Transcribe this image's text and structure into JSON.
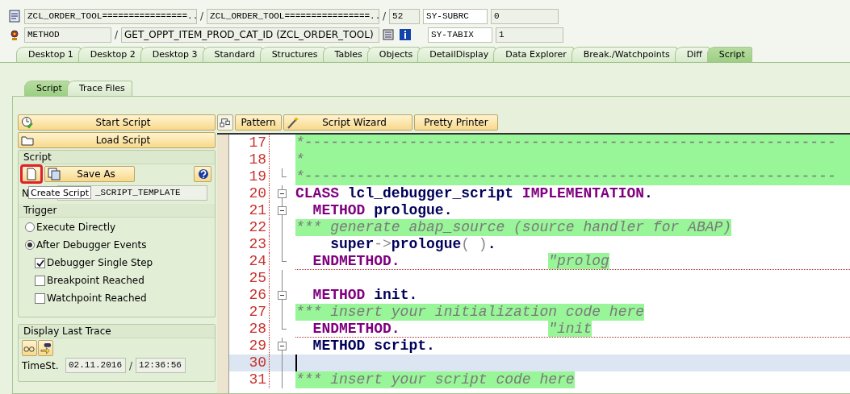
{
  "header": {
    "row_1": {
      "program": "ZCL_ORDER_TOOL================..",
      "include": "ZCL_ORDER_TOOL================..",
      "line": "52",
      "sysvar": "SY-SUBRC",
      "sysvalue": "0"
    },
    "row_2": {
      "event_type": "METHOD",
      "event": "GET_OPPT_ITEM_PROD_CAT_ID (ZCL_ORDER_TOOL)",
      "sysvar": "SY-TABIX",
      "sysvalue": "1"
    },
    "separator": "/"
  },
  "tabs": [
    {
      "label": "Desktop 1",
      "selected": false
    },
    {
      "label": "Desktop 2",
      "selected": false
    },
    {
      "label": "Desktop 3",
      "selected": false
    },
    {
      "label": "Standard",
      "selected": false
    },
    {
      "label": "Structures",
      "selected": false
    },
    {
      "label": "Tables",
      "selected": false
    },
    {
      "label": "Objects",
      "selected": false
    },
    {
      "label": "DetailDisplay",
      "selected": false
    },
    {
      "label": "Data Explorer",
      "selected": false
    },
    {
      "label": "Break./Watchpoints",
      "selected": false
    },
    {
      "label": "Diff",
      "selected": false
    },
    {
      "label": "Script",
      "selected": true
    }
  ],
  "subtabs": [
    {
      "label": "Script",
      "selected": true
    },
    {
      "label": "Trace Files",
      "selected": false
    }
  ],
  "left_panel": {
    "start_button": "Start Script",
    "load_button": "Load Script",
    "script_group": {
      "title": "Script",
      "save_as_button": "Save As",
      "name_label": "N",
      "name_value": "_SCRIPT_TEMPLATE",
      "tooltip": "Create Script",
      "new_button_highlighted": true
    },
    "trigger_group": {
      "title": "Trigger",
      "options": [
        {
          "kind": "radio",
          "label": "Execute Directly",
          "selected": false
        },
        {
          "kind": "radio",
          "label": "After Debugger Events",
          "selected": true
        },
        {
          "kind": "checkbox",
          "label": "Debugger Single Step",
          "checked": true
        },
        {
          "kind": "checkbox",
          "label": "Breakpoint Reached",
          "checked": false
        },
        {
          "kind": "checkbox",
          "label": "Watchpoint Reached",
          "checked": false
        }
      ]
    },
    "trace_group": {
      "title": "Display Last Trace",
      "timestamp_label": "TimeSt.",
      "date": "02.11.2016",
      "separator": "/",
      "time": "12:36:56"
    }
  },
  "editor": {
    "toolbar": {
      "pattern_button": "Pattern",
      "wizard_button": "Script Wizard",
      "pretty_printer_button": "Pretty Printer"
    },
    "lines": [
      {
        "number": "17",
        "collapsible": false,
        "block_end": false,
        "current": false,
        "separator": false,
        "segments": [
          {
            "kind": "comment",
            "text": "*-------------------------------------------------------------",
            "fill": true
          }
        ]
      },
      {
        "number": "18",
        "collapsible": false,
        "block_end": false,
        "current": false,
        "separator": false,
        "segments": [
          {
            "kind": "comment",
            "text": "*",
            "fill": true
          }
        ]
      },
      {
        "number": "19",
        "collapsible": false,
        "block_end": true,
        "current": false,
        "separator": false,
        "segments": [
          {
            "kind": "comment",
            "text": "*-------------------------------------------------------------",
            "fill": true
          }
        ]
      },
      {
        "number": "20",
        "collapsible": true,
        "block_end": false,
        "current": false,
        "separator": false,
        "segments": [
          {
            "kind": "keyword",
            "text": "CLASS"
          },
          {
            "kind": "ident",
            "text": " lcl_debugger_script "
          },
          {
            "kind": "keyword",
            "text": "IMPLEMENTATION"
          },
          {
            "kind": "ident",
            "text": "."
          }
        ]
      },
      {
        "number": "21",
        "collapsible": true,
        "block_end": false,
        "current": false,
        "separator": false,
        "segments": [
          {
            "kind": "keyword",
            "text": "  METHOD"
          },
          {
            "kind": "ident",
            "text": " prologue."
          }
        ]
      },
      {
        "number": "22",
        "collapsible": false,
        "block_end": false,
        "current": false,
        "separator": false,
        "segments": [
          {
            "kind": "comment",
            "text": "*** generate abap_source (source handler for ABAP)"
          }
        ]
      },
      {
        "number": "23",
        "collapsible": false,
        "block_end": false,
        "current": false,
        "separator": false,
        "segments": [
          {
            "kind": "ident",
            "text": "    super"
          },
          {
            "kind": "op",
            "text": "->"
          },
          {
            "kind": "ident",
            "text": "prologue"
          },
          {
            "kind": "op",
            "text": "( )"
          },
          {
            "kind": "ident",
            "text": "."
          }
        ]
      },
      {
        "number": "24",
        "collapsible": false,
        "block_end": true,
        "current": false,
        "separator": true,
        "segments": [
          {
            "kind": "keyword",
            "text": "  ENDMETHOD.                 "
          },
          {
            "kind": "comment",
            "text": "\"prolog"
          }
        ]
      },
      {
        "number": "25",
        "collapsible": false,
        "block_end": false,
        "current": false,
        "separator": false
      },
      {
        "number": "26",
        "collapsible": true,
        "block_end": false,
        "current": false,
        "separator": false,
        "segments": [
          {
            "kind": "keyword",
            "text": "  METHOD"
          },
          {
            "kind": "ident",
            "text": " init."
          }
        ]
      },
      {
        "number": "27",
        "collapsible": false,
        "block_end": false,
        "current": false,
        "separator": false,
        "segments": [
          {
            "kind": "comment",
            "text": "*** insert your initialization code here"
          }
        ]
      },
      {
        "number": "28",
        "collapsible": false,
        "block_end": true,
        "current": false,
        "separator": true,
        "segments": [
          {
            "kind": "keyword",
            "text": "  ENDMETHOD.                 "
          },
          {
            "kind": "comment",
            "text": "\"init"
          }
        ]
      },
      {
        "number": "29",
        "collapsible": true,
        "block_end": false,
        "current": false,
        "separator": false,
        "segments": [
          {
            "kind": "ident",
            "text": "  METHOD script."
          }
        ]
      },
      {
        "number": "30",
        "collapsible": false,
        "block_end": false,
        "current": true,
        "separator": false
      },
      {
        "number": "31",
        "collapsible": false,
        "block_end": false,
        "current": false,
        "separator": false,
        "segments": [
          {
            "kind": "comment",
            "text": "*** insert your script code here"
          }
        ]
      }
    ]
  }
}
